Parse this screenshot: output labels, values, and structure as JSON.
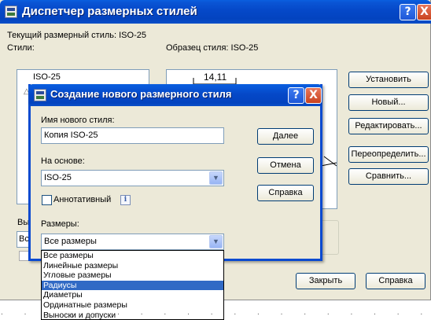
{
  "outer_dialog": {
    "title": "Диспетчер размерных стилей",
    "help_button": "?",
    "close_button": "X",
    "current_style_label": "Текущий размерный стиль: ISO-25",
    "styles_label": "Стили:",
    "styles_list": [
      "ISO-25"
    ],
    "preview_label": "Образец стиля: ISO-25",
    "preview_dimension_text": "14,11",
    "list_label_partial": "Вы",
    "filter_value_partial": "Вс",
    "buttons": {
      "set_current": "Установить",
      "new": "Новый...",
      "modify": "Редактировать...",
      "override": "Переопределить...",
      "compare": "Сравнить...",
      "close": "Закрыть",
      "help": "Справка"
    }
  },
  "inner_dialog": {
    "title": "Создание нового размерного стиля",
    "help_button": "?",
    "close_button": "X",
    "new_style_name_label": "Имя нового стиля:",
    "new_style_name_value": "Копия ISO-25",
    "start_with_label": "На основе:",
    "start_with_value": "ISO-25",
    "annotative_label": "Аннотативный",
    "info_icon": "i",
    "use_for_label": "Размеры:",
    "use_for_value": "Все размеры",
    "buttons": {
      "continue": "Далее",
      "cancel": "Отмена",
      "help": "Справка"
    }
  },
  "dropdown": {
    "items": [
      "Все размеры",
      "Линейные размеры",
      "Угловые размеры",
      "Радиусы",
      "Диаметры",
      "Ординатные размеры",
      "Выноски и допуски"
    ],
    "selected_index": 3
  },
  "colors": {
    "title_bar": "#0548c8",
    "dialog_bg": "#ece9d8",
    "selection": "#316ac5",
    "close_button": "#c9421e"
  }
}
